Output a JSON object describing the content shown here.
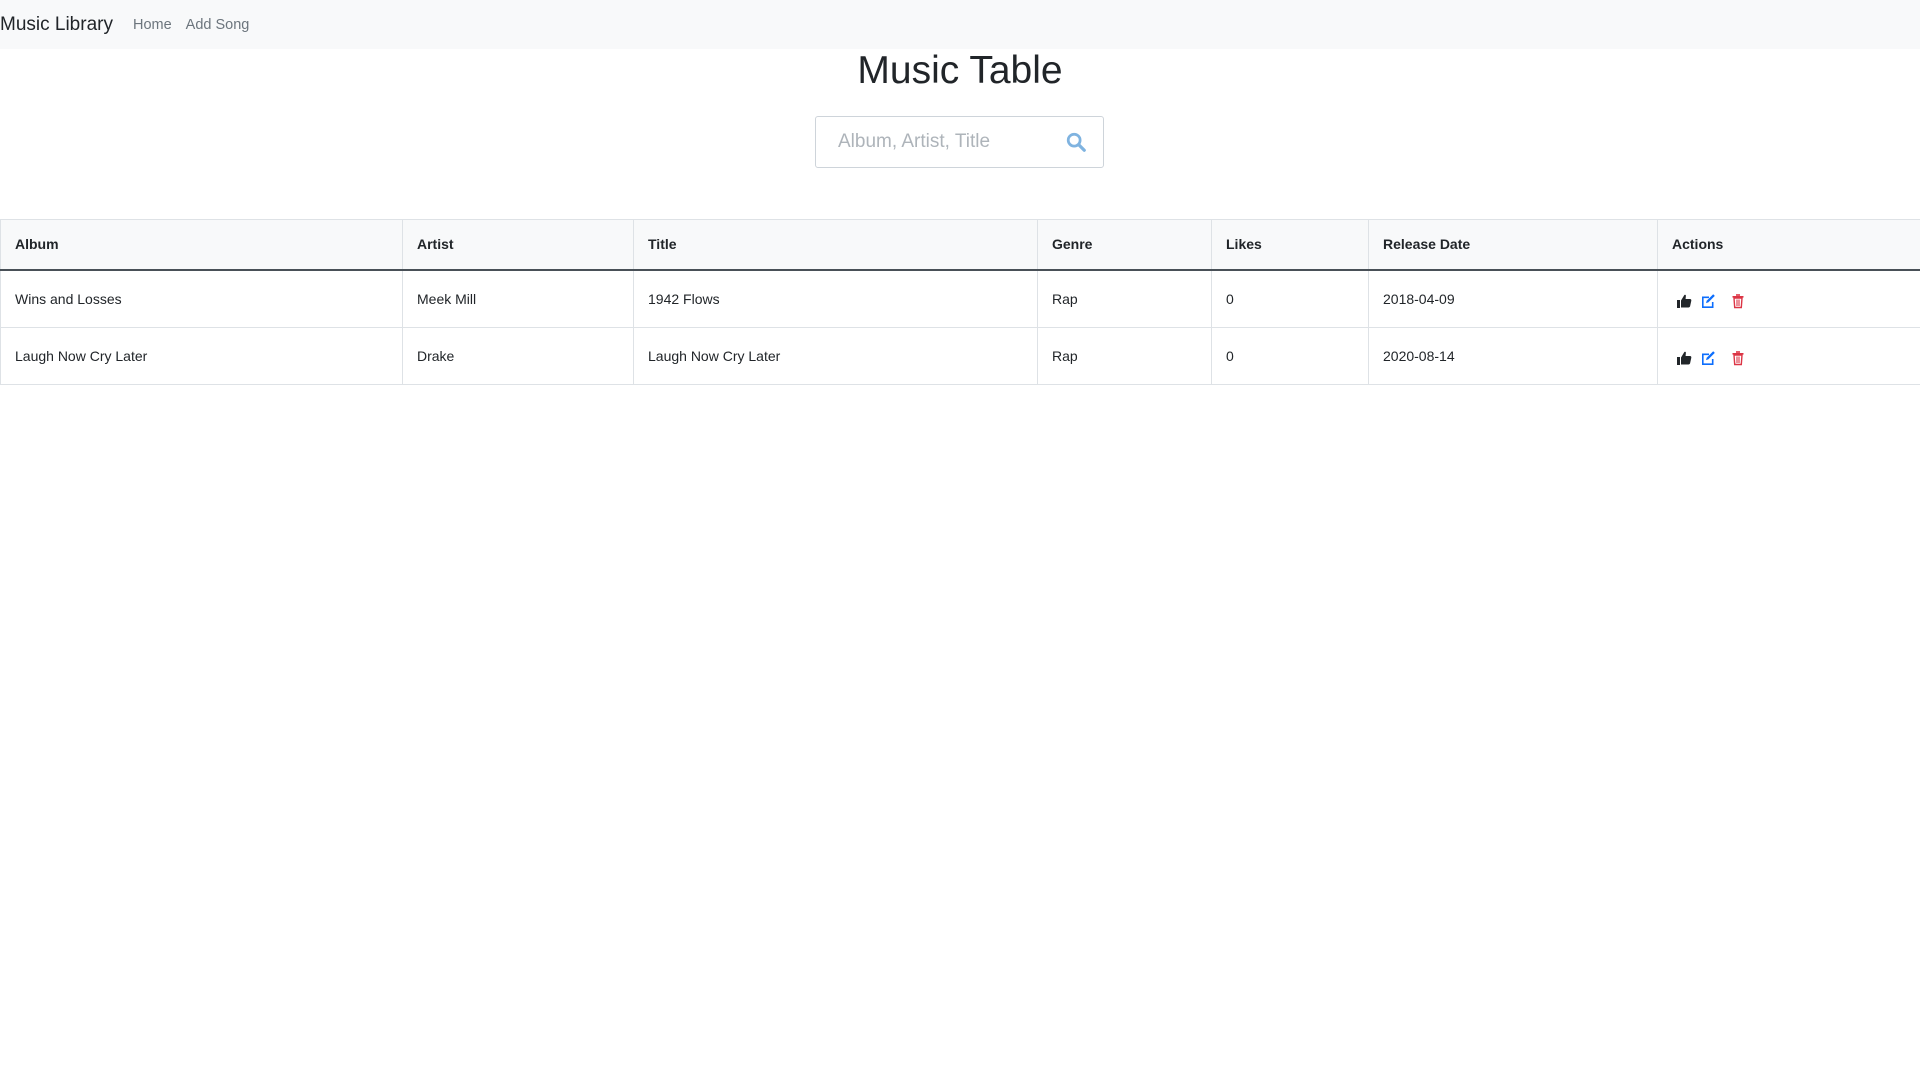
{
  "navbar": {
    "brand": "Music Library",
    "links": [
      "Home",
      "Add Song"
    ]
  },
  "page": {
    "title": "Music Table"
  },
  "search": {
    "placeholder": "Album, Artist, Title",
    "value": ""
  },
  "table": {
    "headers": [
      "Album",
      "Artist",
      "Title",
      "Genre",
      "Likes",
      "Release Date",
      "Actions"
    ],
    "rows": [
      [
        "Wins and Losses",
        "Meek Mill",
        "1942 Flows",
        "Rap",
        "0",
        "2018-04-09"
      ],
      [
        "Laugh Now Cry Later",
        "Drake",
        "Laugh Now Cry Later",
        "Rap",
        "0",
        "2020-08-14"
      ]
    ]
  },
  "colors": {
    "navbar_bg": "#f8f9fa",
    "search_icon": "#7fb3e0",
    "edit_icon": "#0d6efd",
    "delete_icon": "#dc3545",
    "like_icon": "#212529"
  },
  "icons": {
    "search": "search-icon",
    "like": "thumbs-up-icon",
    "edit": "edit-icon",
    "delete": "trash-icon"
  }
}
